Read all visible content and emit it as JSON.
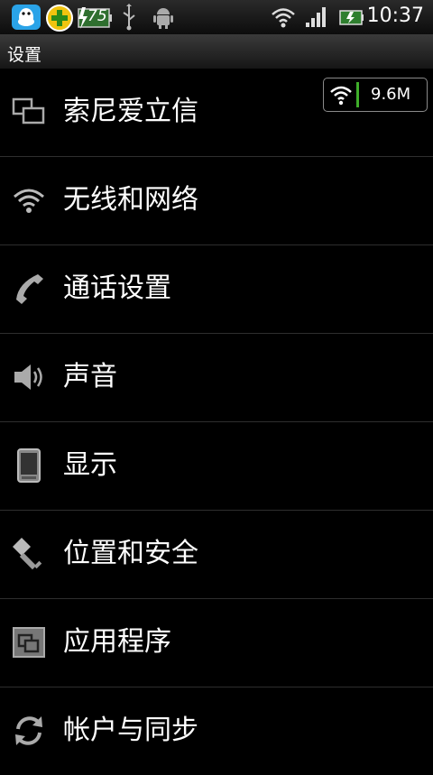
{
  "status_bar": {
    "time": "10:37",
    "battery_level": "75",
    "icons": [
      "qq-icon",
      "plus-icon",
      "battery-icon",
      "usb-icon",
      "android-icon",
      "wifi-icon",
      "signal-icon",
      "battery-status-icon"
    ]
  },
  "title_bar": {
    "title": "设置"
  },
  "net_widget": {
    "value": "9.6M"
  },
  "menu": {
    "items": [
      {
        "label": "索尼爱立信",
        "icon": "windows-icon"
      },
      {
        "label": "无线和网络",
        "icon": "wifi-icon"
      },
      {
        "label": "通话设置",
        "icon": "phone-handset-icon"
      },
      {
        "label": "声音",
        "icon": "speaker-icon"
      },
      {
        "label": "显示",
        "icon": "display-icon"
      },
      {
        "label": "位置和安全",
        "icon": "key-icon"
      },
      {
        "label": "应用程序",
        "icon": "applications-icon"
      },
      {
        "label": "帐户与同步",
        "icon": "sync-icon"
      }
    ]
  },
  "colors": {
    "background": "#000000",
    "divider": "#2e2e2e",
    "accent_green": "#3fae2a",
    "qq_blue": "#2aa3e8",
    "plus_yellow": "#f1c40f"
  }
}
